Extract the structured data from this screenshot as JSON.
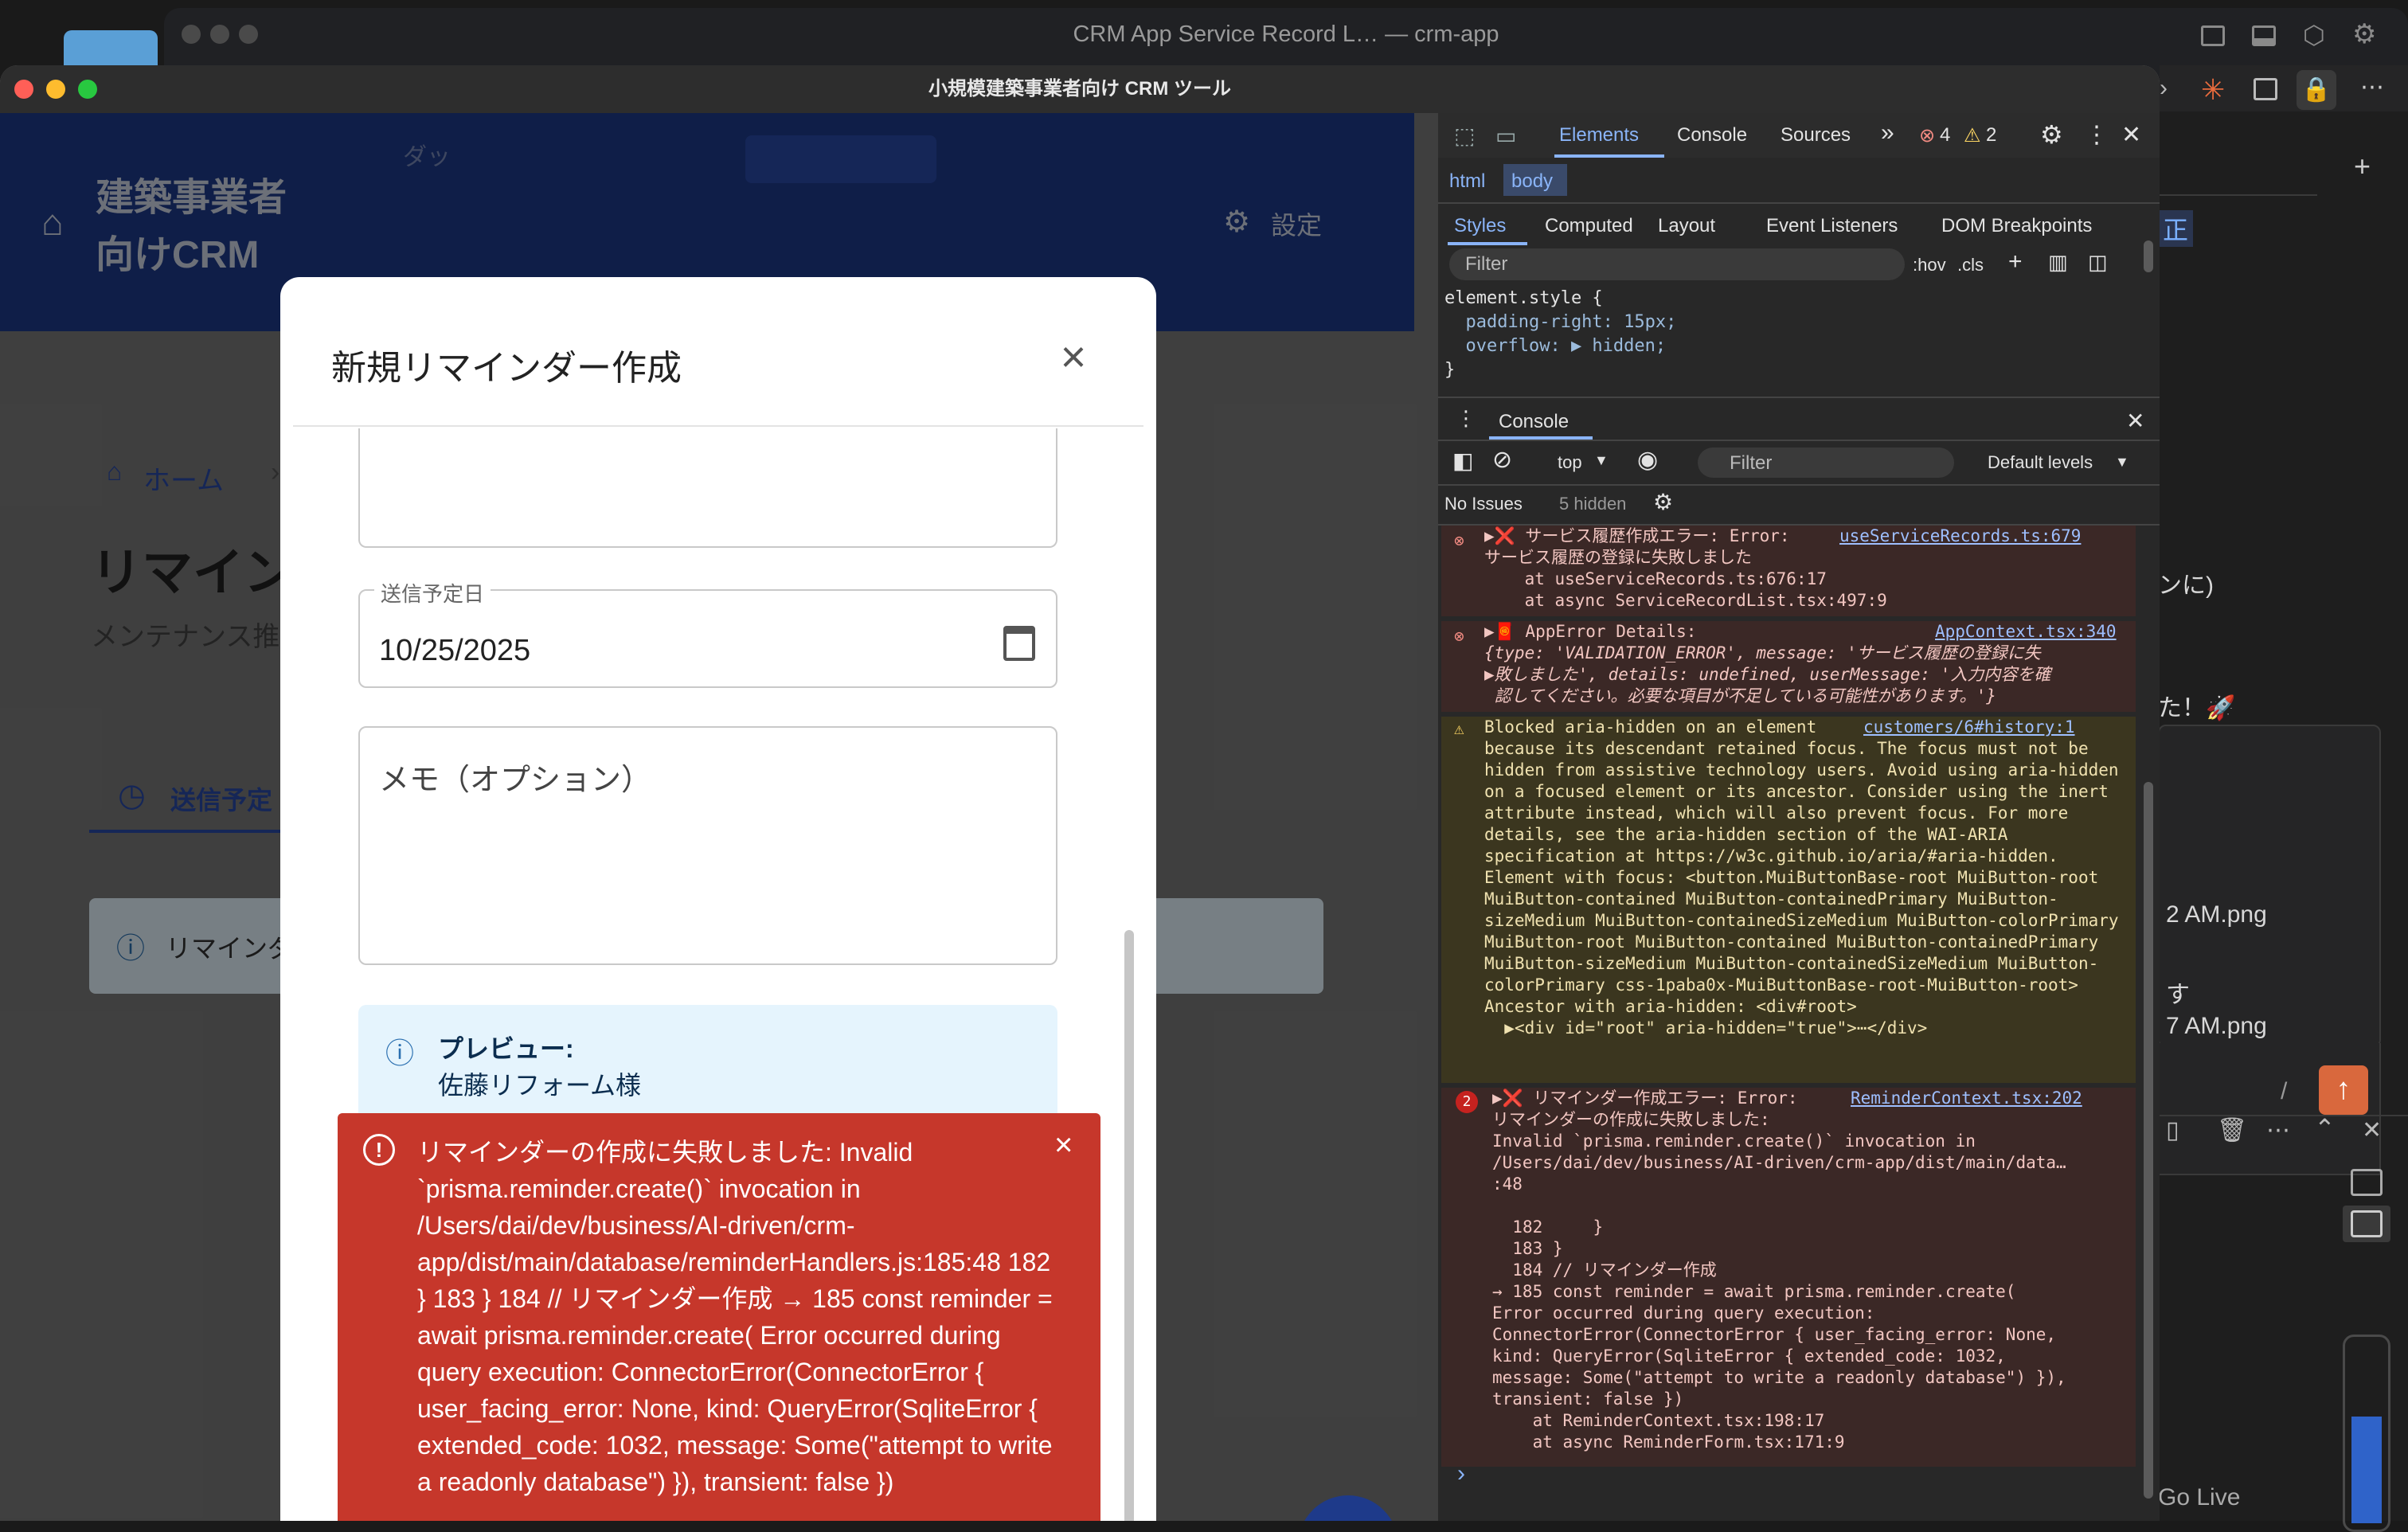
{
  "ide": {
    "title": "CRM App Service Record L… — crm-app",
    "right_panel": {
      "badge": "正",
      "lines": [
        "ンに)",
        "た！🚀",
        "2 AM.png",
        "す",
        "7 AM.png",
        "/"
      ],
      "go_live": "Go Live"
    }
  },
  "app": {
    "window_title": "小規模建築事業者向け CRM ツール",
    "appbar": {
      "brand_line1": "建築事業者",
      "brand_line2": "向けCRM",
      "nav_partial": "ダッ",
      "settings_label": "設定"
    },
    "background": {
      "breadcrumb_home": "ホーム",
      "breadcrumb_sep": "›",
      "page_title": "リマイン",
      "page_subtitle": "メンテナンス推",
      "tab_scheduled": "送信予定",
      "alert_text": "リマインダ"
    },
    "modal": {
      "title": "新規リマインダー作成",
      "close_icon": "×",
      "date_label": "送信予定日",
      "date_value": "10/25/2025",
      "memo_placeholder": "メモ（オプション）",
      "preview_label": "プレビュー:",
      "preview_text": "佐藤リフォーム様"
    },
    "error_snackbar": {
      "message": "リマインダーの作成に失敗しました: Invalid `prisma.reminder.create()` invocation in /Users/dai/dev/business/AI-driven/crm-app/dist/main/database/reminderHandlers.js:185:48 182 } 183 } 184 // リマインダー作成 → 185 const reminder = await prisma.reminder.create( Error occurred during query execution: ConnectorError(ConnectorError { user_facing_error: None, kind: QueryError(SqliteError { extended_code: 1032, message: Some(\"attempt to write a readonly database\") }), transient: false })",
      "close_icon": "×"
    },
    "fab_icon": "+"
  },
  "devtools": {
    "tabs": [
      "Elements",
      "Console",
      "Sources"
    ],
    "more_tabs": "»",
    "error_count": "4",
    "warning_count": "2",
    "breadcrumb": [
      "html",
      "body"
    ],
    "styles_tabs": [
      "Styles",
      "Computed",
      "Layout",
      "Event Listeners",
      "DOM Breakpoints"
    ],
    "filter_placeholder": "Filter",
    "hov": ":hov",
    "cls": ".cls",
    "css_lines": [
      "element.style {",
      "  padding-right: 15px;",
      "  overflow: ▶ hidden;",
      "}"
    ],
    "drawer_tab": "Console",
    "context": "top",
    "console_filter": "Filter",
    "levels": "Default levels",
    "no_issues": "No Issues",
    "hidden": "5 hidden",
    "messages": [
      {
        "kind": "error",
        "text": "▶❌ サービス履歴作成エラー: Error:",
        "source": "useServiceRecords.ts:679",
        "body": "サービス履歴の登録に失敗しました\n    at useServiceRecords.ts:676:17\n    at async ServiceRecordList.tsx:497:9"
      },
      {
        "kind": "error",
        "text": "▶🧧 AppError Details:",
        "source": "AppContext.tsx:340",
        "body": "{type: 'VALIDATION_ERROR', message: 'サービス履歴の登録に失\n▶敗しました', details: undefined, userMessage: '入力内容を確\n 認してください。必要な項目が不足している可能性があります。'}"
      },
      {
        "kind": "warning",
        "text": "Blocked aria-hidden on an element",
        "source": "customers/6#history:1",
        "body": "because its descendant retained focus. The focus must not be hidden from assistive technology users. Avoid using aria-hidden on a focused element or its ancestor. Consider using the inert attribute instead, which will also prevent focus. For more details, see the aria-hidden section of the WAI-ARIA specification at https://w3c.github.io/aria/#aria-hidden.\nElement with focus: <button.MuiButtonBase-root MuiButton-root MuiButton-contained MuiButton-containedPrimary MuiButton-sizeMedium MuiButton-containedSizeMedium MuiButton-colorPrimary MuiButton-root MuiButton-contained MuiButton-containedPrimary MuiButton-sizeMedium MuiButton-containedSizeMedium MuiButton-colorPrimary css-1paba0x-MuiButtonBase-root-MuiButton-root>\nAncestor with aria-hidden: <div#root>\n  ▶<div id=\"root\" aria-hidden=\"true\">⋯</div>"
      },
      {
        "kind": "error",
        "count": "2",
        "text": "▶❌ リマインダー作成エラー: Error:",
        "source": "ReminderContext.tsx:202",
        "body": "リマインダーの作成に失敗しました:\nInvalid `prisma.reminder.create()` invocation in\n/Users/dai/dev/business/AI-driven/crm-app/dist/main/data…\n:48\n\n  182     }\n  183 }\n  184 // リマインダー作成\n→ 185 const reminder = await prisma.reminder.create(\nError occurred during query execution:\nConnectorError(ConnectorError { user_facing_error: None,\nkind: QueryError(SqliteError { extended_code: 1032,\nmessage: Some(\"attempt to write a readonly database\") }),\ntransient: false })\n    at ReminderContext.tsx:198:17\n    at async ReminderForm.tsx:171:9"
      }
    ],
    "prompt": "›"
  },
  "colors": {
    "appbar": "#1e3a8a",
    "error": "#c6372b",
    "devtools_bg": "#282828",
    "preview_bg": "#e5f4fd"
  }
}
